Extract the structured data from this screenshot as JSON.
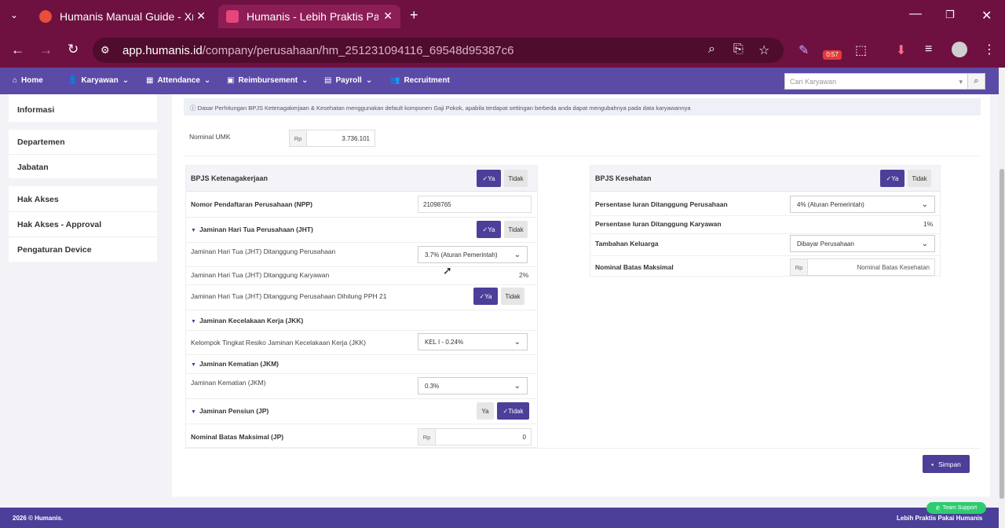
{
  "browser": {
    "tabs": [
      {
        "title": "Humanis Manual Guide - Xmind",
        "favicon_color": "#e84e3a"
      },
      {
        "title": "Humanis - Lebih Praktis Pakai Humanis",
        "favicon_color": "#e7457c"
      }
    ],
    "url_host": "app.humanis.id",
    "url_path": "/company/perusahaan/hm_251231094116_69548d95387c6",
    "timer_badge": "0:57"
  },
  "nav": {
    "items": [
      {
        "label": "Home",
        "icon": "home-icon"
      },
      {
        "label": "Karyawan",
        "icon": "user-edit-icon"
      },
      {
        "label": "Attendance",
        "icon": "calendar-icon"
      },
      {
        "label": "Reimbursement",
        "icon": "money-icon"
      },
      {
        "label": "Payroll",
        "icon": "wallet-icon"
      },
      {
        "label": "Recruitment",
        "icon": "users-icon"
      }
    ],
    "search_placeholder": "Cari Karyawan"
  },
  "sidebar": {
    "informasi": "Informasi",
    "departemen": "Departemen",
    "jabatan": "Jabatan",
    "hak_akses": "Hak Akses",
    "hak_akses_approval": "Hak Akses - Approval",
    "pengaturan_device": "Pengaturan Device"
  },
  "main": {
    "info": "Dasar Perhitungan BPJS Ketenagakerjaan & Kesehatan menggunakan default komponen Gaji Pokok, apabila terdapat settingan berbeda anda dapat mengubahnya pada data karyawannya",
    "umk_label": "Nominal UMK",
    "rp": "Rp",
    "umk_value": "3.736.101",
    "yes": "Ya",
    "no": "Tidak",
    "save": "Simpan"
  },
  "bpjs_tk": {
    "title": "BPJS Ketenagakerjaan",
    "npp_label": "Nomor Pendaftaran Perusahaan (NPP)",
    "npp_value": "21098765",
    "jht_title": "Jaminan Hari Tua Perusahaan (JHT)",
    "jht_company_label": "Jaminan Hari Tua (JHT) Ditanggung Perusahaan",
    "jht_company_value": "3.7% (Aturan Pemerintah)",
    "jht_employee_label": "Jaminan Hari Tua (JHT) Ditanggung Karyawan",
    "jht_employee_value": "2%",
    "jht_pph_label": "Jaminan Hari Tua (JHT) Ditanggung Perusahaan Dihitung PPH 21",
    "jkk_title": "Jaminan Kecelakaan Kerja (JKK)",
    "jkk_label": "Kelompok Tingkat Resiko Jaminan Kecelakaan Kerja (JKK)",
    "jkk_value": "KEL I - 0.24%",
    "jkm_title": "Jaminan Kematian (JKM)",
    "jkm_label": "Jaminan Kematian (JKM)",
    "jkm_value": "0.3%",
    "jp_title": "Jaminan Pensiun (JP)",
    "jp_max_label": "Nominal Batas Maksimal (JP)",
    "jp_max_value": "0"
  },
  "bpjs_kes": {
    "title": "BPJS Kesehatan",
    "company_label": "Persentase Iuran Ditanggung Perusahaan",
    "company_value": "4% (Aturan Pemerintah)",
    "employee_label": "Persentase Iuran Ditanggung Karyawan",
    "employee_value": "1%",
    "family_label": "Tambahan Keluarga",
    "family_value": "Dibayar Perusahaan",
    "max_label": "Nominal Batas Maksimal",
    "max_placeholder": "Nominal Batas Kesehatan"
  },
  "footer": {
    "copyright": "2026 © Humanis.",
    "tagline": "Lebih Praktis Pakai Humanis",
    "support": "Team Support"
  }
}
